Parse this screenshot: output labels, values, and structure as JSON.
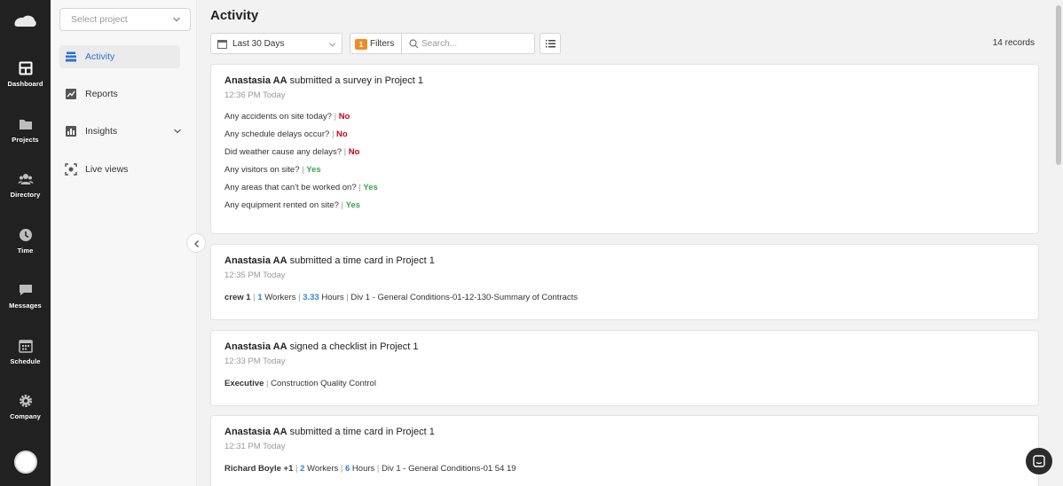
{
  "rail": {
    "items": [
      {
        "label": "Dashboard",
        "icon": "dashboard-icon"
      },
      {
        "label": "Projects",
        "icon": "folder-icon"
      },
      {
        "label": "Directory",
        "icon": "people-icon"
      },
      {
        "label": "Time",
        "icon": "clock-icon"
      },
      {
        "label": "Messages",
        "icon": "chat-bubble-icon"
      },
      {
        "label": "Schedule",
        "icon": "calendar-icon"
      },
      {
        "label": "Company",
        "icon": "gear-icon"
      }
    ]
  },
  "nav": {
    "project_placeholder": "Select project",
    "items": [
      {
        "label": "Activity",
        "icon": "activity-icon"
      },
      {
        "label": "Reports",
        "icon": "trend-icon"
      },
      {
        "label": "Insights",
        "icon": "bar-chart-icon"
      },
      {
        "label": "Live views",
        "icon": "camera-focus-icon"
      }
    ]
  },
  "main": {
    "title": "Activity",
    "date_range": "Last 30 Days",
    "filters_label": "Filters",
    "filters_count": "1",
    "search_placeholder": "Search...",
    "records": "14 records"
  },
  "cards": [
    {
      "user": "Anastasia AA",
      "action": " submitted a survey in Project 1",
      "time": "12:36 PM Today",
      "survey": [
        {
          "q": "Any accidents on site today? ",
          "a": "No",
          "positive": false
        },
        {
          "q": "Any schedule delays occur? ",
          "a": "No",
          "positive": false
        },
        {
          "q": "Did weather cause any delays? ",
          "a": "No",
          "positive": false
        },
        {
          "q": "Any visitors on site? ",
          "a": "Yes",
          "positive": true
        },
        {
          "q": "Any areas that can't be worked on? ",
          "a": "Yes",
          "positive": true
        },
        {
          "q": "Any equipment rented on site? ",
          "a": "Yes",
          "positive": true
        }
      ]
    },
    {
      "user": "Anastasia AA",
      "action": " submitted a time card in Project 1",
      "time": "12:35 PM Today",
      "crew": "crew 1",
      "workers": "1",
      "workers_label": " Workers ",
      "hours": "3.33",
      "hours_label": " Hours ",
      "cost_code": " Div 1 - General Conditions-01-12-130-Summary of Contracts"
    },
    {
      "user": "Anastasia AA",
      "action": " signed a checklist in Project 1",
      "time": "12:33 PM Today",
      "role": "Executive",
      "checklist": " Construction Quality Control"
    },
    {
      "user": "Anastasia AA",
      "action": " submitted a time card in Project 1",
      "time": "12:31 PM Today",
      "crew": "Richard Boyle +1",
      "workers": "2",
      "workers_label": " Workers ",
      "hours": "6",
      "hours_label": " Hours ",
      "cost_code": " Div 1 - General Conditions-01 54 19"
    }
  ],
  "separator": "|",
  "colors": {
    "rail": "#212121",
    "accent": "#2f6fd0",
    "no": "#d0021b",
    "yes": "#3aa54a",
    "badge": "#f08a24"
  }
}
